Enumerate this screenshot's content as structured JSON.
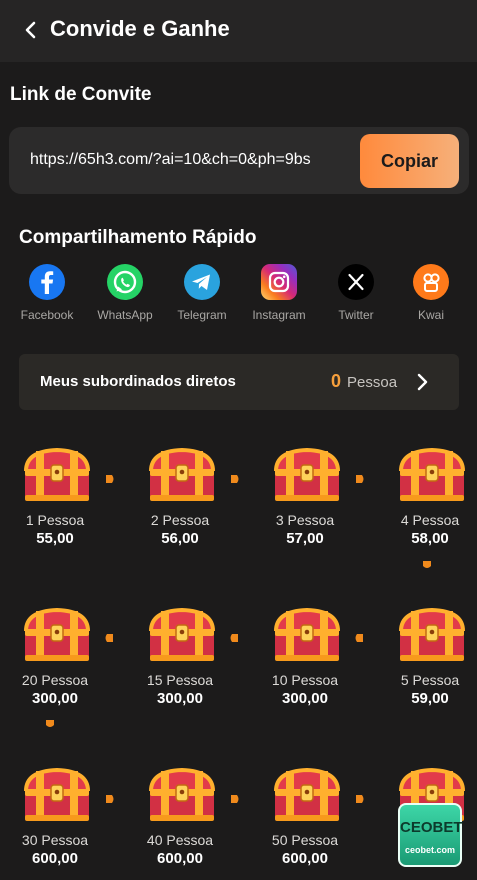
{
  "header": {
    "title": "Convide e Ganhe"
  },
  "invite": {
    "section_title": "Link de Convite",
    "link": "https://65h3.com/?ai=10&ch=0&ph=9bs",
    "copy_label": "Copiar"
  },
  "share": {
    "title": "Compartilhamento Rápido",
    "items": [
      {
        "label": "Facebook",
        "icon": "facebook-icon",
        "color": "#1877f2"
      },
      {
        "label": "WhatsApp",
        "icon": "whatsapp-icon",
        "color": "#25d366"
      },
      {
        "label": "Telegram",
        "icon": "telegram-icon",
        "color": "#2aa3de"
      },
      {
        "label": "Instagram",
        "icon": "instagram-icon",
        "color": "#d6249f"
      },
      {
        "label": "Twitter",
        "icon": "x-icon",
        "color": "#000000"
      },
      {
        "label": "Kwai",
        "icon": "kwai-icon",
        "color": "#ff7a1a"
      }
    ]
  },
  "subordinates": {
    "label": "Meus subordinados diretos",
    "count": "0",
    "unit": "Pessoa"
  },
  "rewards": [
    {
      "caption": "1 Pessoa",
      "amount": "55,00"
    },
    {
      "caption": "2 Pessoa",
      "amount": "56,00"
    },
    {
      "caption": "3 Pessoa",
      "amount": "57,00"
    },
    {
      "caption": "4 Pessoa",
      "amount": "58,00"
    },
    {
      "caption": "20 Pessoa",
      "amount": "300,00"
    },
    {
      "caption": "15 Pessoa",
      "amount": "300,00"
    },
    {
      "caption": "10 Pessoa",
      "amount": "300,00"
    },
    {
      "caption": "5 Pessoa",
      "amount": "59,00"
    },
    {
      "caption": "30 Pessoa",
      "amount": "600,00"
    },
    {
      "caption": "40 Pessoa",
      "amount": "600,00"
    },
    {
      "caption": "50 Pessoa",
      "amount": "600,00"
    },
    {
      "caption": "",
      "amount": ""
    }
  ],
  "watermark": {
    "brand": "CEOBET",
    "site": "ceobet.com"
  },
  "colors": {
    "accent": "#f69f3c",
    "background": "#1c1b1b"
  }
}
